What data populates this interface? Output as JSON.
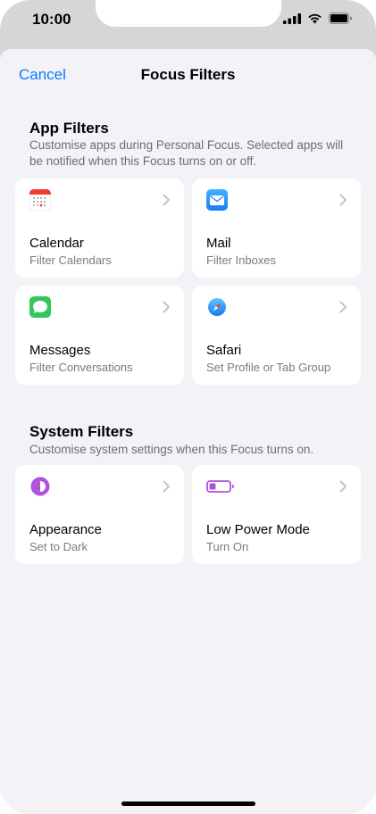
{
  "status_bar": {
    "time": "10:00",
    "icons": [
      "cellular-signal-icon",
      "wifi-icon",
      "battery-icon"
    ]
  },
  "nav": {
    "cancel_label": "Cancel",
    "title": "Focus Filters",
    "accent_color": "#0a7aff"
  },
  "app_filters": {
    "title": "App Filters",
    "description": "Customise apps during Personal Focus. Selected apps will be notified when this Focus turns on or off.",
    "items": [
      {
        "title": "Calendar",
        "subtitle": "Filter Calendars",
        "icon": "calendar-icon"
      },
      {
        "title": "Mail",
        "subtitle": "Filter Inboxes",
        "icon": "mail-icon"
      },
      {
        "title": "Messages",
        "subtitle": "Filter Conversations",
        "icon": "messages-icon"
      },
      {
        "title": "Safari",
        "subtitle": "Set Profile or Tab Group",
        "icon": "safari-icon"
      }
    ]
  },
  "system_filters": {
    "title": "System Filters",
    "description": "Customise system settings when this Focus turns on.",
    "items": [
      {
        "title": "Appearance",
        "subtitle": "Set to Dark",
        "icon": "appearance-icon"
      },
      {
        "title": "Low Power Mode",
        "subtitle": "Turn On",
        "icon": "low-power-battery-icon"
      }
    ]
  }
}
